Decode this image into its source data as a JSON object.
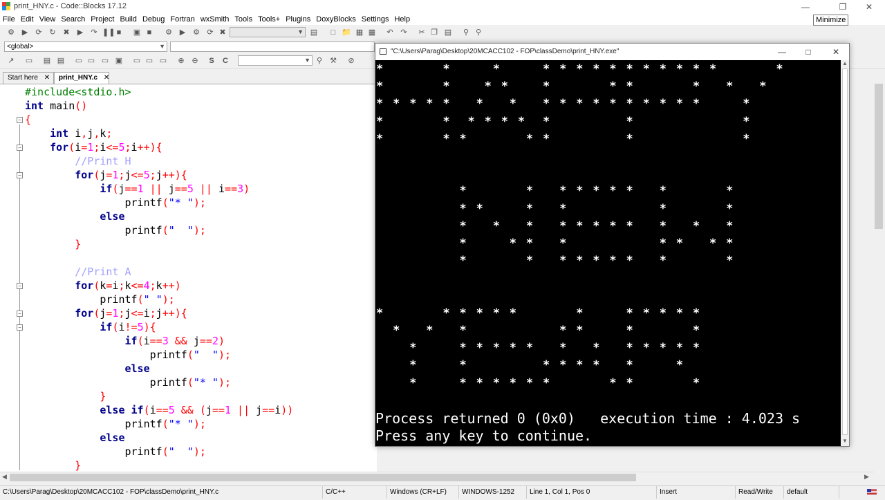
{
  "window": {
    "title": "print_HNY.c - Code::Blocks 17.12",
    "tooltip": "Minimize"
  },
  "menu": [
    "File",
    "Edit",
    "View",
    "Search",
    "Project",
    "Build",
    "Debug",
    "Fortran",
    "wxSmith",
    "Tools",
    "Tools+",
    "Plugins",
    "DoxyBlocks",
    "Settings",
    "Help"
  ],
  "toolbar": {
    "scope_combo": "<global>"
  },
  "tabs": [
    {
      "label": "Start here",
      "active": false
    },
    {
      "label": "print_HNY.c",
      "active": true
    }
  ],
  "code_lines": [
    [
      {
        "t": "#include<stdio.h>",
        "c": "pp"
      }
    ],
    [
      {
        "t": "int",
        "c": "kw"
      },
      {
        "t": " main",
        "c": "tx"
      },
      {
        "t": "()",
        "c": "op"
      }
    ],
    [
      {
        "t": "{",
        "c": "op"
      }
    ],
    [
      {
        "t": "    ",
        "c": "tx"
      },
      {
        "t": "int",
        "c": "kw"
      },
      {
        "t": " i",
        "c": "tx"
      },
      {
        "t": ",",
        "c": "op"
      },
      {
        "t": "j",
        "c": "tx"
      },
      {
        "t": ",",
        "c": "op"
      },
      {
        "t": "k",
        "c": "tx"
      },
      {
        "t": ";",
        "c": "op"
      }
    ],
    [
      {
        "t": "    ",
        "c": "tx"
      },
      {
        "t": "for",
        "c": "kw"
      },
      {
        "t": "(",
        "c": "op"
      },
      {
        "t": "i",
        "c": "tx"
      },
      {
        "t": "=",
        "c": "op"
      },
      {
        "t": "1",
        "c": "nu"
      },
      {
        "t": ";",
        "c": "op"
      },
      {
        "t": "i",
        "c": "tx"
      },
      {
        "t": "<=",
        "c": "op"
      },
      {
        "t": "5",
        "c": "nu"
      },
      {
        "t": ";",
        "c": "op"
      },
      {
        "t": "i",
        "c": "tx"
      },
      {
        "t": "++){",
        "c": "op"
      }
    ],
    [
      {
        "t": "        ",
        "c": "tx"
      },
      {
        "t": "//Print H",
        "c": "cm"
      }
    ],
    [
      {
        "t": "        ",
        "c": "tx"
      },
      {
        "t": "for",
        "c": "kw"
      },
      {
        "t": "(",
        "c": "op"
      },
      {
        "t": "j",
        "c": "tx"
      },
      {
        "t": "=",
        "c": "op"
      },
      {
        "t": "1",
        "c": "nu"
      },
      {
        "t": ";",
        "c": "op"
      },
      {
        "t": "j",
        "c": "tx"
      },
      {
        "t": "<=",
        "c": "op"
      },
      {
        "t": "5",
        "c": "nu"
      },
      {
        "t": ";",
        "c": "op"
      },
      {
        "t": "j",
        "c": "tx"
      },
      {
        "t": "++){",
        "c": "op"
      }
    ],
    [
      {
        "t": "            ",
        "c": "tx"
      },
      {
        "t": "if",
        "c": "kw"
      },
      {
        "t": "(",
        "c": "op"
      },
      {
        "t": "j",
        "c": "tx"
      },
      {
        "t": "==",
        "c": "op"
      },
      {
        "t": "1",
        "c": "nu"
      },
      {
        "t": " || ",
        "c": "op"
      },
      {
        "t": "j",
        "c": "tx"
      },
      {
        "t": "==",
        "c": "op"
      },
      {
        "t": "5",
        "c": "nu"
      },
      {
        "t": " || ",
        "c": "op"
      },
      {
        "t": "i",
        "c": "tx"
      },
      {
        "t": "==",
        "c": "op"
      },
      {
        "t": "3",
        "c": "nu"
      },
      {
        "t": ")",
        "c": "op"
      }
    ],
    [
      {
        "t": "                printf",
        "c": "tx"
      },
      {
        "t": "(",
        "c": "op"
      },
      {
        "t": "\"* \"",
        "c": "st"
      },
      {
        "t": ");",
        "c": "op"
      }
    ],
    [
      {
        "t": "            ",
        "c": "tx"
      },
      {
        "t": "else",
        "c": "kw"
      }
    ],
    [
      {
        "t": "                printf",
        "c": "tx"
      },
      {
        "t": "(",
        "c": "op"
      },
      {
        "t": "\"  \"",
        "c": "st"
      },
      {
        "t": ");",
        "c": "op"
      }
    ],
    [
      {
        "t": "        ",
        "c": "tx"
      },
      {
        "t": "}",
        "c": "op"
      }
    ],
    [
      {
        "t": "",
        "c": "tx"
      }
    ],
    [
      {
        "t": "        ",
        "c": "tx"
      },
      {
        "t": "//Print A",
        "c": "cm"
      }
    ],
    [
      {
        "t": "        ",
        "c": "tx"
      },
      {
        "t": "for",
        "c": "kw"
      },
      {
        "t": "(",
        "c": "op"
      },
      {
        "t": "k",
        "c": "tx"
      },
      {
        "t": "=",
        "c": "op"
      },
      {
        "t": "i",
        "c": "tx"
      },
      {
        "t": ";",
        "c": "op"
      },
      {
        "t": "k",
        "c": "tx"
      },
      {
        "t": "<=",
        "c": "op"
      },
      {
        "t": "4",
        "c": "nu"
      },
      {
        "t": ";",
        "c": "op"
      },
      {
        "t": "k",
        "c": "tx"
      },
      {
        "t": "++)",
        "c": "op"
      }
    ],
    [
      {
        "t": "            printf",
        "c": "tx"
      },
      {
        "t": "(",
        "c": "op"
      },
      {
        "t": "\" \"",
        "c": "st"
      },
      {
        "t": ");",
        "c": "op"
      }
    ],
    [
      {
        "t": "        ",
        "c": "tx"
      },
      {
        "t": "for",
        "c": "kw"
      },
      {
        "t": "(",
        "c": "op"
      },
      {
        "t": "j",
        "c": "tx"
      },
      {
        "t": "=",
        "c": "op"
      },
      {
        "t": "1",
        "c": "nu"
      },
      {
        "t": ";",
        "c": "op"
      },
      {
        "t": "j",
        "c": "tx"
      },
      {
        "t": "<=",
        "c": "op"
      },
      {
        "t": "i",
        "c": "tx"
      },
      {
        "t": ";",
        "c": "op"
      },
      {
        "t": "j",
        "c": "tx"
      },
      {
        "t": "++){",
        "c": "op"
      }
    ],
    [
      {
        "t": "            ",
        "c": "tx"
      },
      {
        "t": "if",
        "c": "kw"
      },
      {
        "t": "(",
        "c": "op"
      },
      {
        "t": "i",
        "c": "tx"
      },
      {
        "t": "!=",
        "c": "op"
      },
      {
        "t": "5",
        "c": "nu"
      },
      {
        "t": "){",
        "c": "op"
      }
    ],
    [
      {
        "t": "                ",
        "c": "tx"
      },
      {
        "t": "if",
        "c": "kw"
      },
      {
        "t": "(",
        "c": "op"
      },
      {
        "t": "i",
        "c": "tx"
      },
      {
        "t": "==",
        "c": "op"
      },
      {
        "t": "3",
        "c": "nu"
      },
      {
        "t": " && ",
        "c": "op"
      },
      {
        "t": "j",
        "c": "tx"
      },
      {
        "t": "==",
        "c": "op"
      },
      {
        "t": "2",
        "c": "nu"
      },
      {
        "t": ")",
        "c": "op"
      }
    ],
    [
      {
        "t": "                    printf",
        "c": "tx"
      },
      {
        "t": "(",
        "c": "op"
      },
      {
        "t": "\"  \"",
        "c": "st"
      },
      {
        "t": ");",
        "c": "op"
      }
    ],
    [
      {
        "t": "                ",
        "c": "tx"
      },
      {
        "t": "else",
        "c": "kw"
      }
    ],
    [
      {
        "t": "                    printf",
        "c": "tx"
      },
      {
        "t": "(",
        "c": "op"
      },
      {
        "t": "\"* \"",
        "c": "st"
      },
      {
        "t": ");",
        "c": "op"
      }
    ],
    [
      {
        "t": "            ",
        "c": "tx"
      },
      {
        "t": "}",
        "c": "op"
      }
    ],
    [
      {
        "t": "            ",
        "c": "tx"
      },
      {
        "t": "else if",
        "c": "kw"
      },
      {
        "t": "(",
        "c": "op"
      },
      {
        "t": "i",
        "c": "tx"
      },
      {
        "t": "==",
        "c": "op"
      },
      {
        "t": "5",
        "c": "nu"
      },
      {
        "t": " && (",
        "c": "op"
      },
      {
        "t": "j",
        "c": "tx"
      },
      {
        "t": "==",
        "c": "op"
      },
      {
        "t": "1",
        "c": "nu"
      },
      {
        "t": " || ",
        "c": "op"
      },
      {
        "t": "j",
        "c": "tx"
      },
      {
        "t": "==",
        "c": "op"
      },
      {
        "t": "i",
        "c": "tx"
      },
      {
        "t": "))",
        "c": "op"
      }
    ],
    [
      {
        "t": "                printf",
        "c": "tx"
      },
      {
        "t": "(",
        "c": "op"
      },
      {
        "t": "\"* \"",
        "c": "st"
      },
      {
        "t": ");",
        "c": "op"
      }
    ],
    [
      {
        "t": "            ",
        "c": "tx"
      },
      {
        "t": "else",
        "c": "kw"
      }
    ],
    [
      {
        "t": "                printf",
        "c": "tx"
      },
      {
        "t": "(",
        "c": "op"
      },
      {
        "t": "\"  \"",
        "c": "st"
      },
      {
        "t": ");",
        "c": "op"
      }
    ],
    [
      {
        "t": "        ",
        "c": "tx"
      },
      {
        "t": "}",
        "c": "op"
      }
    ]
  ],
  "console": {
    "title": "\"C:\\Users\\Parag\\Desktop\\20MCACC102 - FOP\\classDemo\\print_HNY.exe\"",
    "star_rows": [
      [
        0,
        4,
        7,
        10,
        11,
        12,
        13,
        14,
        15,
        16,
        17,
        18,
        19,
        20,
        24
      ],
      [
        0,
        4,
        6.5,
        7.5,
        10,
        14,
        15,
        19,
        21,
        23
      ],
      [
        0,
        1,
        2,
        3,
        4,
        6,
        8,
        10,
        11,
        12,
        13,
        14,
        15,
        16,
        17,
        18,
        19,
        22
      ],
      [
        0,
        4,
        5.5,
        6.5,
        7.5,
        8.5,
        10,
        15,
        22
      ],
      [
        0,
        4,
        5,
        9,
        10,
        15,
        22
      ],
      [],
      [],
      [
        5,
        9,
        11,
        12,
        13,
        14,
        15,
        17,
        21
      ],
      [
        5,
        6,
        9,
        11,
        17,
        21
      ],
      [
        5,
        7,
        9,
        11,
        12,
        13,
        14,
        15,
        17,
        19,
        21
      ],
      [
        5,
        8,
        9,
        11,
        17,
        18,
        20,
        21
      ],
      [
        5,
        9,
        11,
        12,
        13,
        14,
        15,
        17,
        21
      ],
      [],
      [],
      [
        0,
        4,
        5,
        6,
        7,
        8,
        12,
        15,
        16,
        17,
        18,
        19
      ],
      [
        1,
        3,
        5,
        11,
        12,
        15,
        19
      ],
      [
        2,
        5,
        6,
        7,
        8,
        9,
        11,
        13,
        15,
        16,
        17,
        18,
        19
      ],
      [
        2,
        5,
        10,
        11,
        12,
        13,
        15,
        18
      ],
      [
        2,
        5,
        6,
        7,
        8,
        9,
        10,
        14,
        15,
        19
      ]
    ],
    "process_line": "Process returned 0 (0x0)   execution time : 4.023 s",
    "continue_line": "Press any key to continue."
  },
  "statusbar": {
    "path": "C:\\Users\\Parag\\Desktop\\20MCACC102 - FOP\\classDemo\\print_HNY.c",
    "lang": "C/C++",
    "eol": "Windows (CR+LF)",
    "encoding": "WINDOWS-1252",
    "position": "Line 1, Col 1, Pos 0",
    "mode": "Insert",
    "access": "Read/Write",
    "profile": "default"
  },
  "colors": {
    "keyword": "#00008b",
    "preprocessor": "#008000",
    "comment": "#a0a0ff",
    "string": "#0000ff",
    "number": "#ff00ff",
    "operator": "#ff0000",
    "console_bg": "#000000",
    "console_fg": "#ffffff"
  }
}
